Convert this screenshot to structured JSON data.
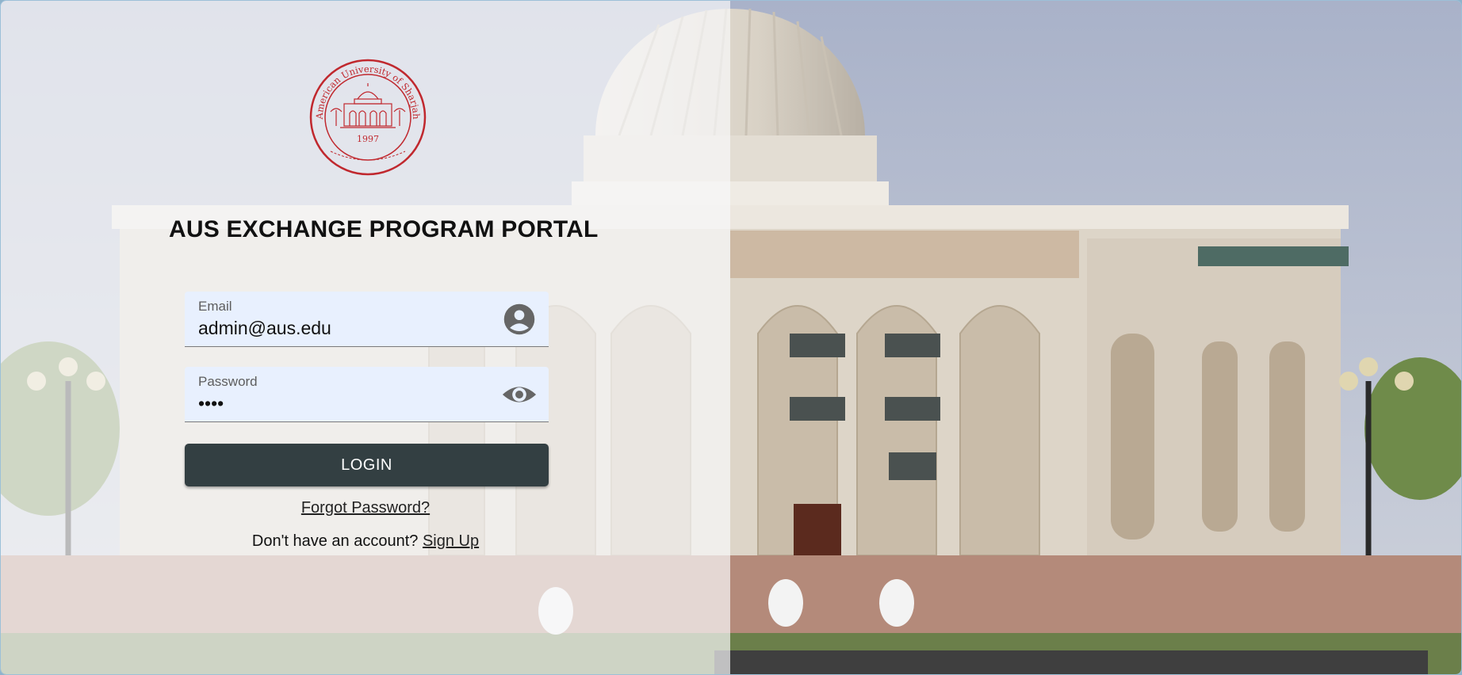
{
  "seal": {
    "name": "American University of Sharjah",
    "year": "1997"
  },
  "title": "AUS EXCHANGE PROGRAM PORTAL",
  "email": {
    "label": "Email",
    "value": "admin@aus.edu",
    "icon": "account-circle-icon"
  },
  "password": {
    "label": "Password",
    "value": "1234",
    "icon": "eye-icon"
  },
  "login_label": "LOGIN",
  "forgot_label": "Forgot Password?",
  "signup": {
    "prompt": "Don't have an account?",
    "link": "Sign Up"
  },
  "colors": {
    "button": "#333f42",
    "field_bg": "#e8f0fe",
    "seal": "#c0282e"
  }
}
